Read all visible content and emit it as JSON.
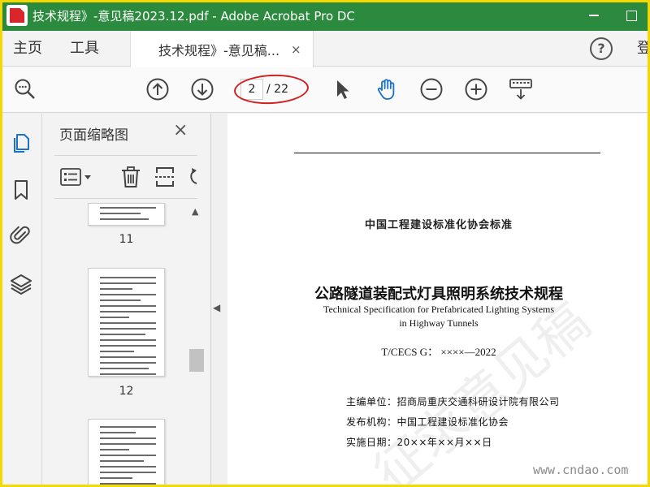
{
  "window": {
    "title": "技术规程》-意见稿2023.12.pdf - Adobe Acrobat Pro DC"
  },
  "menu": {
    "home": "主页",
    "tools": "工具",
    "tab_label": "技术规程》-意见稿...",
    "tab_close": "×",
    "help": "?",
    "signin": "登"
  },
  "toolbar": {
    "current_page": "2",
    "total_pages": "/ 22",
    "icons": [
      "zoom-icon",
      "page-up-icon",
      "page-down-icon",
      "select-arrow-icon",
      "hand-icon",
      "zoom-out-icon",
      "zoom-in-icon",
      "keyboard-icon"
    ],
    "accent_color": "#1a73c9",
    "annotation_color": "#d21e1e"
  },
  "rail": {
    "icons": [
      "pages-icon",
      "bookmark-icon",
      "attachment-icon",
      "layers-icon"
    ]
  },
  "thumbnails": {
    "title": "页面缩略图",
    "close": "×",
    "pages": [
      {
        "number": "11"
      },
      {
        "number": "12"
      }
    ]
  },
  "document": {
    "org": "中国工程建设标准化协会标准",
    "title_cn": "公路隧道装配式灯具照明系统技术规程",
    "title_en_line1": "Technical Specification for Prefabricated Lighting Systems",
    "title_en_line2": "in Highway Tunnels",
    "code": "T/CECS G： ××××—2022",
    "meta": [
      {
        "label": "主编单位：",
        "value": "招商局重庆交通科研设计院有限公司"
      },
      {
        "label": "发布机构：",
        "value": "中国工程建设标准化协会"
      },
      {
        "label": "实施日期：",
        "value": "20××年××月××日"
      }
    ],
    "watermark": "征求意见稿"
  },
  "site_watermark": "www.cndao.com"
}
